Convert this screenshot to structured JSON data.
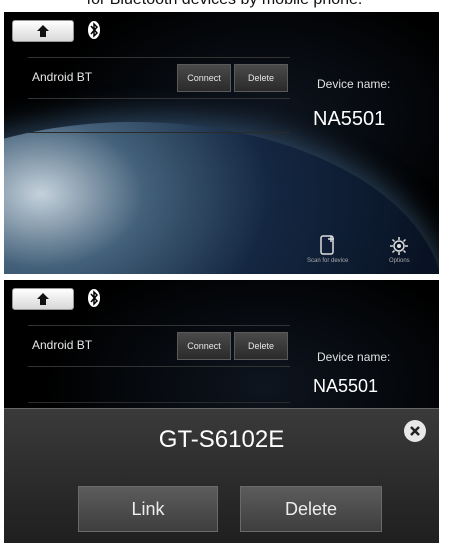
{
  "caption": "for Bluetooth devices by mobile phone.",
  "screen1": {
    "paired_device": "Android BT",
    "connect_label": "Connect",
    "delete_label": "Delete",
    "device_name_label": "Device name:",
    "device_name_value": "NA5501",
    "scan_label": "Scan for device",
    "options_label": "Options"
  },
  "screen2": {
    "paired_device": "Android BT",
    "connect_label": "Connect",
    "delete_label": "Delete",
    "device_name_label": "Device name:",
    "device_name_value": "NA5501",
    "dialog": {
      "title": "GT-S6102E",
      "link_label": "Link",
      "delete_label": "Delete"
    }
  },
  "icons": {
    "home": "home-icon",
    "bluetooth": "bluetooth-icon",
    "scan": "phone-plus-icon",
    "options": "gear-icon",
    "close": "close-icon"
  }
}
